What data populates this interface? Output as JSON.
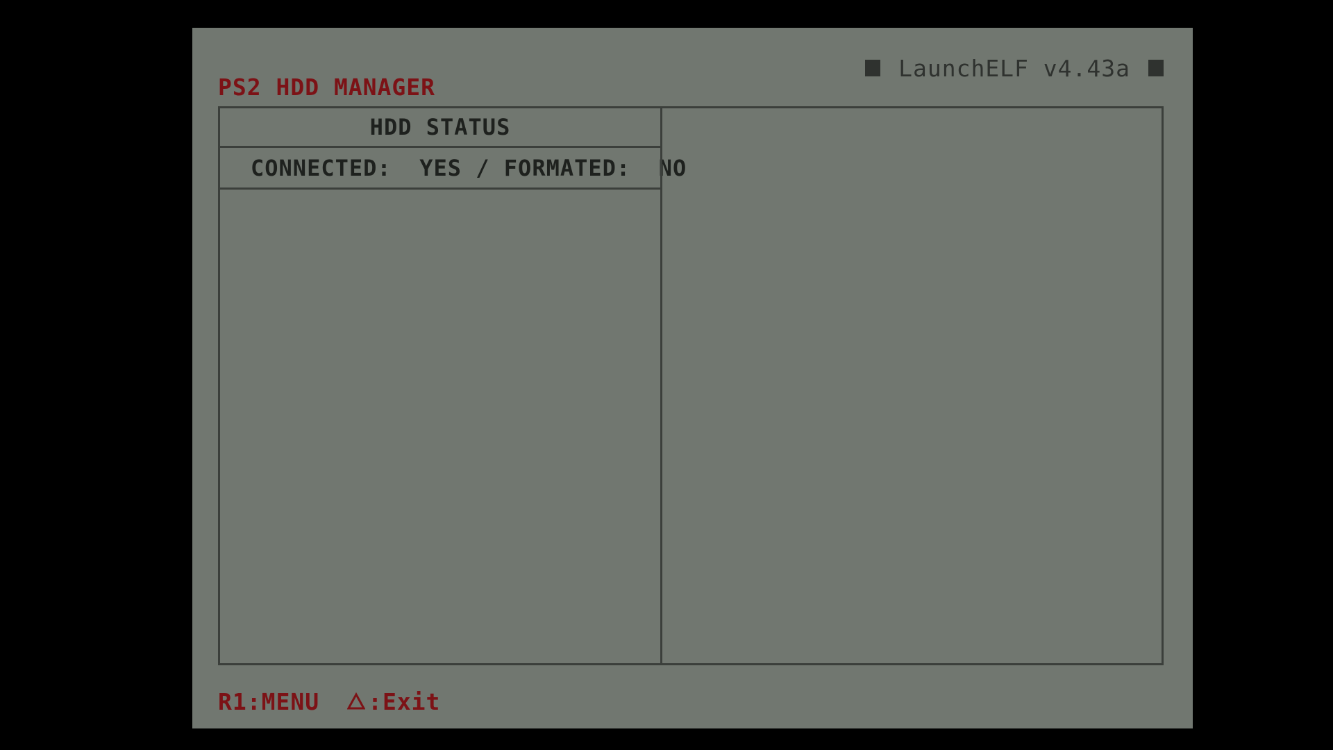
{
  "brand": {
    "text": "LaunchELF v4.43a"
  },
  "title": "PS2 HDD MANAGER",
  "hdd_status": {
    "header": "HDD STATUS",
    "status_line": "CONNECTED:  YES / FORMATED:  NO"
  },
  "footer": {
    "menu_hint": "R1:MENU",
    "exit_icon": "triangle-icon",
    "exit_hint": ":Exit"
  },
  "colors": {
    "screen_background": "#717770",
    "outer_background": "#000000",
    "accent_red": "#7c1216",
    "frame_line": "#3b3f3b",
    "text_dark": "#1e211e"
  }
}
